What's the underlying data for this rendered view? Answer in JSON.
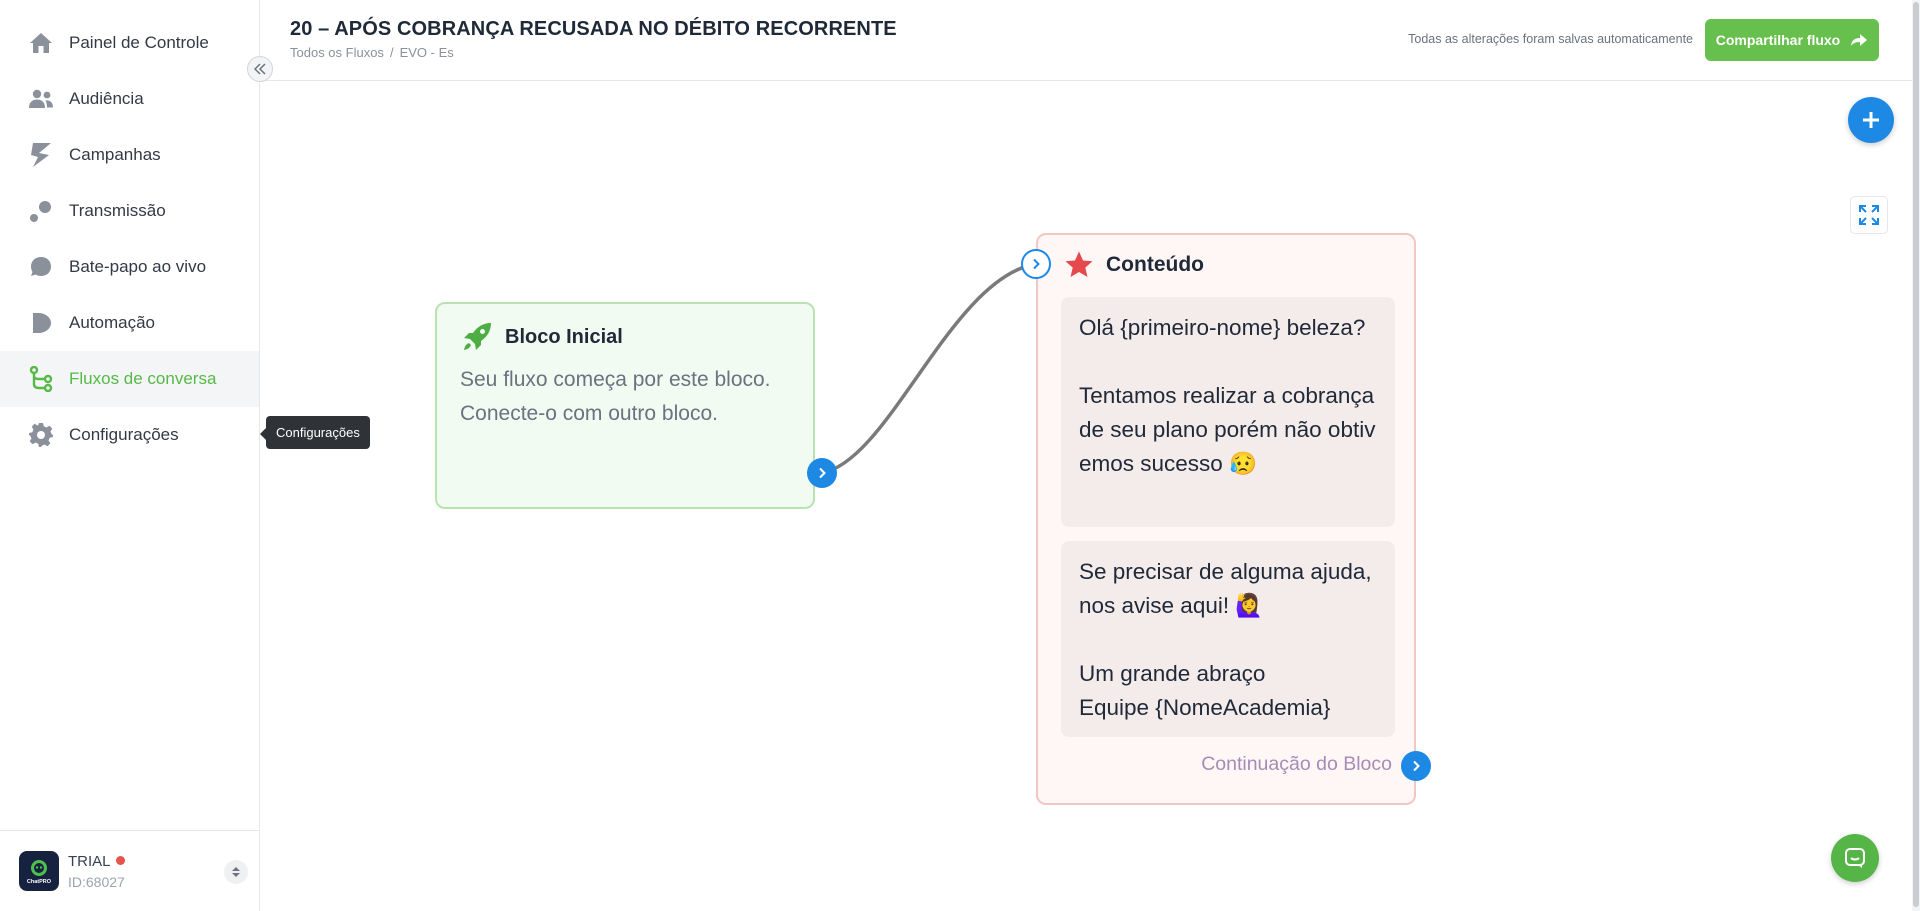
{
  "sidebar": {
    "items": [
      {
        "label": "Painel de Controle",
        "icon": "home-icon"
      },
      {
        "label": "Audiência",
        "icon": "users-icon"
      },
      {
        "label": "Campanhas",
        "icon": "campaigns-icon"
      },
      {
        "label": "Transmissão",
        "icon": "broadcast-icon"
      },
      {
        "label": "Bate-papo ao vivo",
        "icon": "chat-bubble-icon"
      },
      {
        "label": "Automação",
        "icon": "play-icon"
      },
      {
        "label": "Fluxos de conversa",
        "icon": "flow-icon",
        "active": true
      },
      {
        "label": "Configurações",
        "icon": "gear-icon"
      }
    ],
    "tooltip": "Configurações",
    "account": {
      "plan": "TRIAL",
      "id": "ID:68027",
      "logo_text": "ChatPRO"
    }
  },
  "header": {
    "title": "20 – APÓS COBRANÇA RECUSADA NO DÉBITO RECORRENTE",
    "breadcrumb": [
      "Todos os Fluxos",
      "EVO - Es"
    ],
    "save_status": "Todas as alterações foram salvas automaticamente",
    "share_label": "Compartilhar fluxo"
  },
  "canvas": {
    "start_block": {
      "title": "Bloco Inicial",
      "description": "Seu fluxo começa por este bloco. Conecte-o com outro bloco."
    },
    "content_block": {
      "title": "Conteúdo",
      "messages": [
        "Olá {primeiro-nome} beleza?\n\nTentamos realizar a cobrança de seu plano porém não obtivemos sucesso 😥",
        "Se precisar de alguma ajuda, nos avise aqui! 🙋‍♀️\n\nUm grande abraço\nEquipe {NomeAcademia}"
      ],
      "continuation": "Continuação do Bloco"
    }
  },
  "colors": {
    "accent_green": "#57b947",
    "primary_blue": "#1e88e5",
    "start_block_border": "#b8e3b0",
    "content_block_border": "#f1c6c3"
  }
}
